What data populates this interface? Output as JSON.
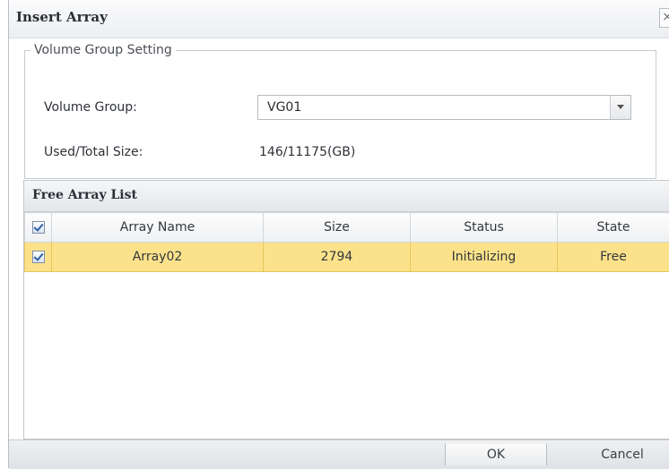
{
  "dialog": {
    "title": "Insert Array",
    "close_glyph": "×"
  },
  "volume_group_setting": {
    "legend": "Volume Group Setting",
    "volume_group_label": "Volume Group:",
    "volume_group_value": "VG01",
    "used_total_label": "Used/Total Size:",
    "used_total_value": "146/11175(GB)"
  },
  "free_array_list": {
    "title": "Free Array List",
    "columns": [
      "Array Name",
      "Size",
      "Status",
      "State"
    ],
    "header_checked": true,
    "rows": [
      {
        "checked": true,
        "selected": true,
        "cells": [
          "Array02",
          "2794",
          "Initializing",
          "Free"
        ]
      }
    ]
  },
  "footer": {
    "ok_label": "OK",
    "cancel_label": "Cancel"
  },
  "colors": {
    "selected_row": "#fbe28a",
    "header_bg": "#e3e6ea",
    "border": "#c3c7cc"
  }
}
